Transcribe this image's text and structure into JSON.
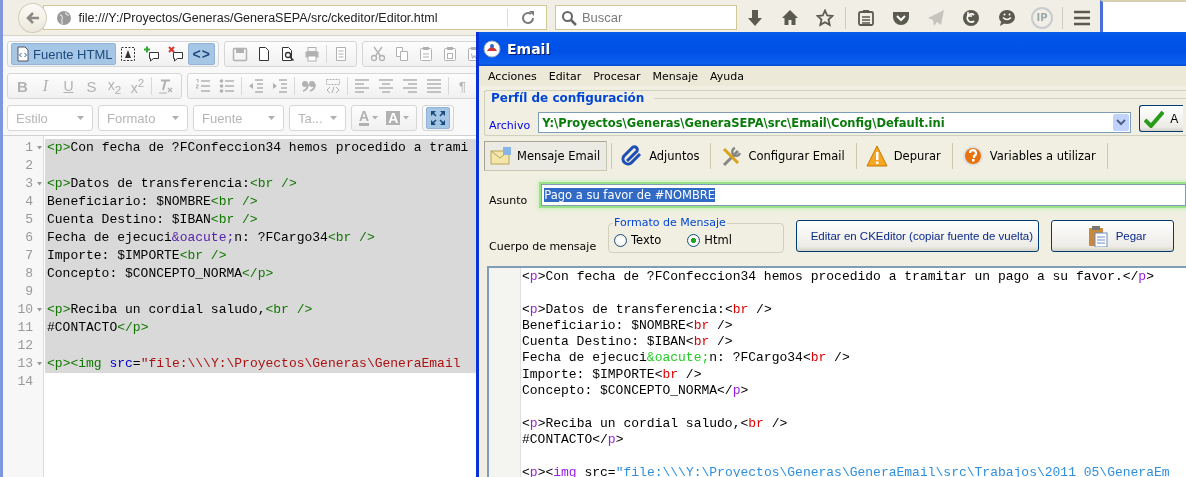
{
  "browser": {
    "url": "file:///Y:/Proyectos/Generas/GeneraSEPA/src/ckeditor/Editor.html",
    "search": {
      "placeholder": "Buscar"
    },
    "toolbar_buttons": [
      {
        "disabled": false
      },
      {
        "disabled": false
      },
      {
        "disabled": false
      },
      {
        "disabled": false
      },
      {
        "disabled": false
      },
      {
        "disabled": true
      },
      {
        "disabled": false
      },
      {
        "disabled": false
      },
      {
        "label": "IP",
        "disabled": false
      },
      {
        "disabled": false
      }
    ]
  },
  "ckeditor": {
    "toolbar": [
      {
        "groups": [
          {
            "kind": "buttons",
            "buttons": [
              {
                "label": "Fuente HTML",
                "on": true,
                "disabled": false
              },
              {
                "on": false,
                "disabled": false
              },
              {
                "on": false,
                "disabled": false
              },
              {
                "on": false,
                "disabled": false
              },
              {
                "label": "<>",
                "on": true,
                "disabled": false
              }
            ]
          },
          {
            "kind": "buttons",
            "buttons": [
              {
                "on": false,
                "disabled": true
              },
              {
                "on": false,
                "disabled": false
              },
              {
                "on": false,
                "disabled": false
              },
              {
                "on": false,
                "disabled": true
              },
              {
                "on": false,
                "disabled": true
              }
            ]
          },
          {
            "kind": "buttons",
            "buttons": [
              {
                "on": false,
                "disabled": true
              },
              {
                "on": false,
                "disabled": true
              },
              {
                "on": false,
                "disabled": true
              },
              {
                "on": false,
                "disabled": true
              },
              {
                "on": false,
                "disabled": true
              }
            ]
          }
        ]
      },
      {
        "groups": [
          {
            "kind": "buttons",
            "buttons": [
              {
                "label": "B",
                "on": false,
                "disabled": true
              },
              {
                "label": "I",
                "on": false,
                "disabled": true
              },
              {
                "label": "U",
                "on": false,
                "disabled": true
              },
              {
                "label": "S",
                "on": false,
                "disabled": true
              },
              {
                "label": "x$_{2}$",
                "on": false,
                "disabled": true
              },
              {
                "label": "x$^{2}$",
                "on": false,
                "disabled": true
              },
              {
                "on": false,
                "disabled": true
              }
            ]
          },
          {
            "kind": "buttons",
            "buttons": [
              {
                "on": false,
                "disabled": true
              },
              {
                "on": false,
                "disabled": true
              },
              {
                "on": false,
                "disabled": true
              },
              {
                "on": false,
                "disabled": true
              },
              {
                "on": false,
                "disabled": true
              },
              {
                "on": false,
                "disabled": true
              },
              {
                "on": false,
                "disabled": true
              },
              {
                "on": false,
                "disabled": true
              },
              {
                "on": false,
                "disabled": true
              },
              {
                "on": false,
                "disabled": true
              },
              {
                "label": "¶",
                "on": false,
                "disabled": true
              }
            ]
          }
        ]
      },
      {
        "groups": [
          {
            "kind": "combo",
            "label": "Estilo",
            "disabled": true
          },
          {
            "kind": "combo",
            "label": "Formato",
            "disabled": true
          },
          {
            "kind": "combo",
            "label": "Fuente",
            "disabled": true
          },
          {
            "kind": "combo",
            "label": "Ta...",
            "disabled": true
          },
          {
            "kind": "buttons",
            "buttons": [
              {
                "label": "A",
                "on": false,
                "disabled": true
              },
              {
                "label": "A",
                "on": false,
                "disabled": true
              }
            ]
          },
          {
            "kind": "buttons",
            "buttons": [
              {
                "on": true,
                "disabled": false
              }
            ]
          }
        ]
      }
    ],
    "source_lines": [
      {
        "number": "1",
        "foldable": true,
        "selected": true,
        "segments": [
          {
            "kind": "punct",
            "text": "<"
          },
          {
            "kind": "tag",
            "text": "p"
          },
          {
            "kind": "punct",
            "text": ">"
          },
          {
            "kind": "text",
            "text": "Con fecha de ?FConfeccion34 hemos procedido a trami"
          }
        ]
      },
      {
        "number": "2",
        "foldable": false,
        "selected": true
      },
      {
        "number": "3",
        "foldable": true,
        "selected": true,
        "segments": [
          {
            "kind": "punct",
            "text": "<"
          },
          {
            "kind": "tag",
            "text": "p"
          },
          {
            "kind": "punct",
            "text": ">"
          },
          {
            "kind": "text",
            "text": "Datos de transferencia:"
          },
          {
            "kind": "punct",
            "text": "<"
          },
          {
            "kind": "void",
            "text": "br"
          },
          {
            "kind": "punct",
            "text": " />"
          }
        ]
      },
      {
        "number": "4",
        "foldable": false,
        "selected": true,
        "segments": [
          {
            "kind": "text",
            "text": "Beneficiario: $NOMBRE"
          },
          {
            "kind": "punct",
            "text": "<"
          },
          {
            "kind": "void",
            "text": "br"
          },
          {
            "kind": "punct",
            "text": " />"
          }
        ]
      },
      {
        "number": "5",
        "foldable": false,
        "selected": true,
        "segments": [
          {
            "kind": "text",
            "text": "Cuenta Destino: $IBAN"
          },
          {
            "kind": "punct",
            "text": "<"
          },
          {
            "kind": "void",
            "text": "br"
          },
          {
            "kind": "punct",
            "text": " />"
          }
        ]
      },
      {
        "number": "6",
        "foldable": false,
        "selected": true,
        "segments": [
          {
            "kind": "text",
            "text": "Fecha de ejecuci"
          },
          {
            "kind": "entity",
            "text": "&oacute;"
          },
          {
            "kind": "text",
            "text": "n: ?FCargo34"
          },
          {
            "kind": "punct",
            "text": "<"
          },
          {
            "kind": "void",
            "text": "br"
          },
          {
            "kind": "punct",
            "text": " />"
          }
        ]
      },
      {
        "number": "7",
        "foldable": false,
        "selected": true,
        "segments": [
          {
            "kind": "text",
            "text": "Importe: $IMPORTE"
          },
          {
            "kind": "punct",
            "text": "<"
          },
          {
            "kind": "void",
            "text": "br"
          },
          {
            "kind": "punct",
            "text": " />"
          }
        ]
      },
      {
        "number": "8",
        "foldable": false,
        "selected": true,
        "segments": [
          {
            "kind": "text",
            "text": "Concepto: $CONCEPTO_NORMA"
          },
          {
            "kind": "punct",
            "text": "</"
          },
          {
            "kind": "tag",
            "text": "p"
          },
          {
            "kind": "punct",
            "text": ">"
          }
        ]
      },
      {
        "number": "9",
        "foldable": false,
        "selected": true
      },
      {
        "number": "10",
        "foldable": true,
        "selected": true,
        "segments": [
          {
            "kind": "punct",
            "text": "<"
          },
          {
            "kind": "tag",
            "text": "p"
          },
          {
            "kind": "punct",
            "text": ">"
          },
          {
            "kind": "text",
            "text": "Reciba un cordial saludo,"
          },
          {
            "kind": "punct",
            "text": "<"
          },
          {
            "kind": "void",
            "text": "br"
          },
          {
            "kind": "punct",
            "text": " />"
          }
        ]
      },
      {
        "number": "11",
        "foldable": false,
        "selected": true,
        "segments": [
          {
            "kind": "text",
            "text": "#CONTACTO"
          },
          {
            "kind": "punct",
            "text": "</"
          },
          {
            "kind": "tag",
            "text": "p"
          },
          {
            "kind": "punct",
            "text": ">"
          }
        ]
      },
      {
        "number": "12",
        "foldable": false,
        "selected": true
      },
      {
        "number": "13",
        "foldable": true,
        "selected": true,
        "segments": [
          {
            "kind": "punct",
            "text": "<"
          },
          {
            "kind": "tag",
            "text": "p"
          },
          {
            "kind": "punct",
            "text": "><"
          },
          {
            "kind": "tag",
            "text": "img"
          },
          {
            "kind": "attr",
            "text": " src"
          },
          {
            "kind": "eq",
            "text": "="
          },
          {
            "kind": "string",
            "text": "\"file:\\\\\\Y:\\Proyectos\\Generas\\GeneraEmail"
          }
        ]
      },
      {
        "number": "14",
        "foldable": false,
        "selected": false
      }
    ]
  },
  "email_window": {
    "title": "Email",
    "menu": [
      "Acciones",
      "Editar",
      "Procesar",
      "Mensaje",
      "Ayuda"
    ],
    "profile": {
      "title": "Perfíl de configuración",
      "file_label": "Archivo",
      "file_value": "Y:\\Proyectos\\Generas\\GeneraSEPA\\src\\Email\\Config\\Default.ini",
      "apply_button": "A"
    },
    "tabs": [
      {
        "label": "Mensaje Email",
        "selected": true
      },
      {
        "label": "Adjuntos",
        "selected": false
      },
      {
        "label": "Configurar Email",
        "selected": false
      },
      {
        "label": "Depurar",
        "selected": false
      },
      {
        "label": "Variables a utilizar",
        "selected": false
      }
    ],
    "subject": {
      "label": "Asunto",
      "value": "Pago a su favor de #NOMBRE",
      "text_selected": true
    },
    "body_label": "Cuerpo de mensaje",
    "format": {
      "title": "Formato de Mensaje",
      "options": [
        {
          "label": "Texto",
          "selected": false
        },
        {
          "label": "Html",
          "selected": true
        }
      ]
    },
    "buttons": [
      "Editar en CKEditor (copiar fuente de vuelta)",
      "Pegar"
    ],
    "source_lines": [
      {
        "kind": "code",
        "segments": [
          {
            "kind": "punct",
            "text": "<"
          },
          {
            "kind": "tag",
            "text": "p"
          },
          {
            "kind": "punct",
            "text": ">"
          },
          {
            "kind": "text",
            "text": "Con fecha de ?FConfeccion34 hemos procedido a tramitar un pago a su favor."
          },
          {
            "kind": "punct",
            "text": "</"
          },
          {
            "kind": "tag",
            "text": "p"
          },
          {
            "kind": "punct",
            "text": ">"
          }
        ]
      },
      {
        "kind": "blank"
      },
      {
        "kind": "code",
        "segments": [
          {
            "kind": "punct",
            "text": "<"
          },
          {
            "kind": "tag",
            "text": "p"
          },
          {
            "kind": "punct",
            "text": ">"
          },
          {
            "kind": "text",
            "text": "Datos de transferencia:"
          },
          {
            "kind": "punct",
            "text": "<"
          },
          {
            "kind": "void",
            "text": "br"
          },
          {
            "kind": "punct",
            "text": " />"
          }
        ]
      },
      {
        "kind": "code",
        "segments": [
          {
            "kind": "text",
            "text": "Beneficiario: $NOMBRE"
          },
          {
            "kind": "punct",
            "text": "<"
          },
          {
            "kind": "void",
            "text": "br"
          },
          {
            "kind": "punct",
            "text": " />"
          }
        ]
      },
      {
        "kind": "code",
        "segments": [
          {
            "kind": "text",
            "text": "Cuenta Destino: $IBAN"
          },
          {
            "kind": "punct",
            "text": "<"
          },
          {
            "kind": "void",
            "text": "br"
          },
          {
            "kind": "punct",
            "text": " />"
          }
        ]
      },
      {
        "kind": "code",
        "segments": [
          {
            "kind": "text",
            "text": "Fecha de ejecuci"
          },
          {
            "kind": "entity",
            "text": "&oacute;"
          },
          {
            "kind": "text",
            "text": "n: ?FCargo34"
          },
          {
            "kind": "punct",
            "text": "<"
          },
          {
            "kind": "void",
            "text": "br"
          },
          {
            "kind": "punct",
            "text": " />"
          }
        ]
      },
      {
        "kind": "code",
        "segments": [
          {
            "kind": "text",
            "text": "Importe: $IMPORTE"
          },
          {
            "kind": "punct",
            "text": "<"
          },
          {
            "kind": "void",
            "text": "br"
          },
          {
            "kind": "punct",
            "text": " />"
          }
        ]
      },
      {
        "kind": "code",
        "segments": [
          {
            "kind": "text",
            "text": "Concepto: $CONCEPTO_NORMA"
          },
          {
            "kind": "punct",
            "text": "</"
          },
          {
            "kind": "tag",
            "text": "p"
          },
          {
            "kind": "punct",
            "text": ">"
          }
        ]
      },
      {
        "kind": "blank"
      },
      {
        "kind": "code",
        "segments": [
          {
            "kind": "punct",
            "text": "<"
          },
          {
            "kind": "tag",
            "text": "p"
          },
          {
            "kind": "punct",
            "text": ">"
          },
          {
            "kind": "text",
            "text": "Reciba un cordial saludo,"
          },
          {
            "kind": "punct",
            "text": "<"
          },
          {
            "kind": "void",
            "text": "br"
          },
          {
            "kind": "punct",
            "text": " />"
          }
        ]
      },
      {
        "kind": "code",
        "segments": [
          {
            "kind": "text",
            "text": "#CONTACTO"
          },
          {
            "kind": "punct",
            "text": "</"
          },
          {
            "kind": "tag",
            "text": "p"
          },
          {
            "kind": "punct",
            "text": ">"
          }
        ]
      },
      {
        "kind": "blank"
      },
      {
        "kind": "code",
        "segments": [
          {
            "kind": "punct",
            "text": "<"
          },
          {
            "kind": "tag",
            "text": "p"
          },
          {
            "kind": "punct",
            "text": "><"
          },
          {
            "kind": "tag",
            "text": "img"
          },
          {
            "kind": "attr",
            "text": " src"
          },
          {
            "kind": "eq",
            "text": "="
          },
          {
            "kind": "string",
            "text": "\"file:\\\\\\Y:\\Proyectos\\Generas\\GeneraEmail\\src\\Trabajos\\2011_05\\GeneraEm"
          }
        ]
      }
    ]
  }
}
